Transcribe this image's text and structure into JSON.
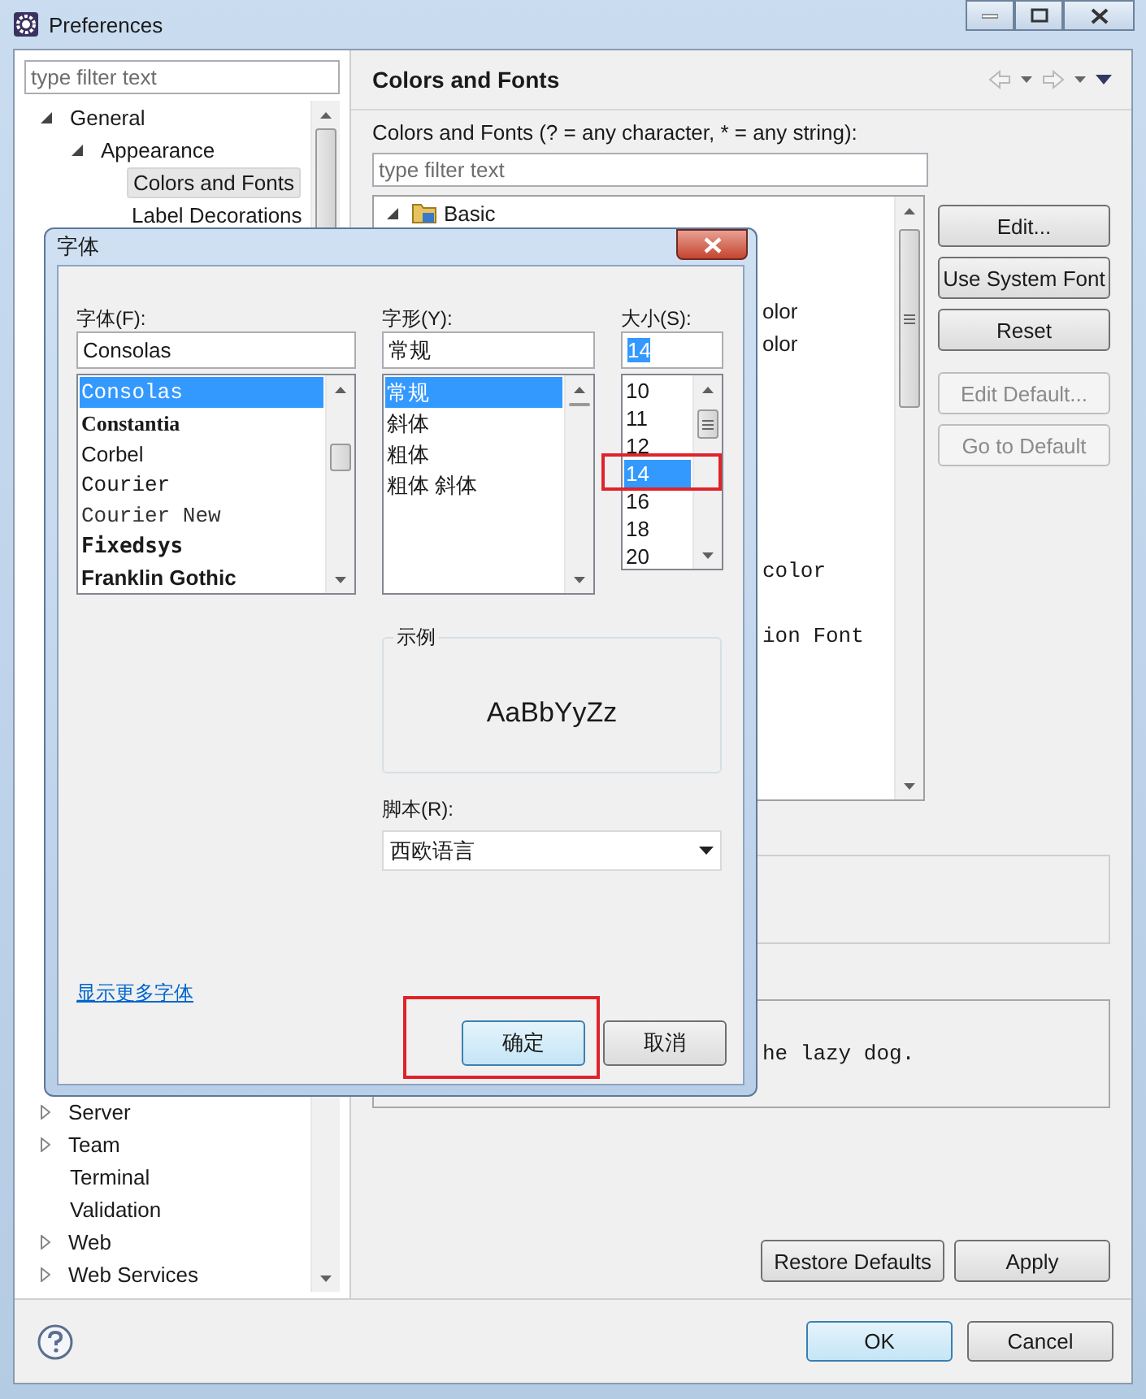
{
  "window": {
    "title": "Preferences"
  },
  "sidebar": {
    "filter": {
      "placeholder": "type filter text"
    },
    "tree": [
      {
        "label": "General",
        "expanded": true,
        "selected": false,
        "children": [
          {
            "label": "Appearance",
            "expanded": true,
            "selected": false,
            "children": [
              {
                "label": "Colors and Fonts",
                "selected": true
              },
              {
                "label": "Label Decorations",
                "selected": false
              }
            ]
          }
        ]
      },
      {
        "label": "Server",
        "expanded": false,
        "selected": false
      },
      {
        "label": "Team",
        "expanded": false,
        "selected": false
      },
      {
        "label": "Terminal",
        "selected": false
      },
      {
        "label": "Validation",
        "selected": false
      },
      {
        "label": "Web",
        "expanded": false,
        "selected": false
      },
      {
        "label": "Web Services",
        "expanded": false,
        "selected": false
      }
    ]
  },
  "page": {
    "title": "Colors and Fonts",
    "filter_label": "Colors and Fonts (? = any character, * = any string):",
    "filter": {
      "placeholder": "type filter text"
    },
    "tree_rows": [
      {
        "text": "Basic",
        "kind": "category",
        "expanded": true
      },
      {
        "text": "olor",
        "kind": "sans"
      },
      {
        "text": "olor",
        "kind": "sans"
      },
      {
        "text": "color",
        "kind": "mono"
      },
      {
        "text": "ion Font",
        "kind": "mono"
      }
    ],
    "buttons": [
      {
        "label": "Edit...",
        "disabled": false
      },
      {
        "label": "Use System Font",
        "disabled": false
      },
      {
        "label": "Reset",
        "disabled": false
      },
      {
        "label": "Edit Default...",
        "disabled": true
      },
      {
        "label": "Go to Default",
        "disabled": true
      }
    ],
    "preview_text": "he lazy dog.",
    "footer_buttons": [
      "Restore Defaults",
      "Apply"
    ]
  },
  "dialog_buttons": [
    {
      "label": "OK",
      "default": true
    },
    {
      "label": "Cancel",
      "default": false
    }
  ],
  "font_dialog": {
    "title": "字体",
    "font": {
      "label": "字体(F):",
      "value": "Consolas",
      "options": [
        {
          "label": "Consolas",
          "kind": "mono",
          "selected": true
        },
        {
          "label": "Constantia",
          "kind": "serif_bold",
          "selected": false
        },
        {
          "label": "Corbel",
          "kind": "sans",
          "selected": false
        },
        {
          "label": "Courier",
          "kind": "mono",
          "selected": false
        },
        {
          "label": "Courier New",
          "kind": "mono_light",
          "selected": false
        },
        {
          "label": "Fixedsys",
          "kind": "mono_bold",
          "selected": false
        },
        {
          "label": "Franklin Gothic",
          "kind": "sans_bold",
          "selected": false
        }
      ]
    },
    "style": {
      "label": "字形(Y):",
      "value": "常规",
      "options": [
        {
          "label": "常规",
          "selected": true
        },
        {
          "label": "斜体",
          "selected": false
        },
        {
          "label": "粗体",
          "selected": false
        },
        {
          "label": "粗体 斜体",
          "selected": false
        }
      ]
    },
    "size": {
      "label": "大小(S):",
      "value": "14",
      "value_selected": true,
      "options": [
        {
          "label": "10",
          "selected": false
        },
        {
          "label": "11",
          "selected": false
        },
        {
          "label": "12",
          "selected": false
        },
        {
          "label": "14",
          "selected": true
        },
        {
          "label": "16",
          "selected": false
        },
        {
          "label": "18",
          "selected": false
        },
        {
          "label": "20",
          "selected": false
        }
      ]
    },
    "sample": {
      "legend": "示例",
      "text": "AaBbYyZz"
    },
    "script": {
      "label": "脚本(R):",
      "value": "西欧语言"
    },
    "more_fonts_link": "显示更多字体",
    "buttons": [
      {
        "label": "确定",
        "default": true
      },
      {
        "label": "取消",
        "default": false
      }
    ]
  }
}
